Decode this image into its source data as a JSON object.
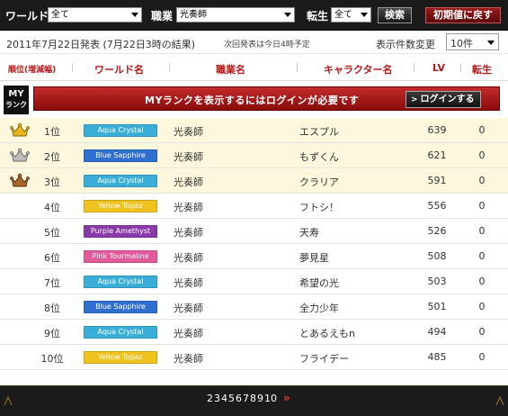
{
  "filters": {
    "world_label": "ワールド",
    "world_value": "全て",
    "job_label": "職業",
    "job_value": "光奏師",
    "rebirth_label": "転生",
    "rebirth_value": "全て",
    "search_button": "検索",
    "reset_button": "初期値に戻す"
  },
  "info": {
    "date": "2011年7月22日発表 (7月22日3時の結果)",
    "next_announce": "次回発表は今日4時予定",
    "count_label": "表示件数変更",
    "count_value": "10件"
  },
  "columns": {
    "rank": "順位(増減幅)",
    "world": "ワールド名",
    "job": "職業名",
    "character": "キャラクター名",
    "lv": "LV",
    "rebirth": "転生"
  },
  "myrank": {
    "label_line1": "MY",
    "label_line2": "ランク",
    "message": "MYランクを表示するにはログインが必要です",
    "login_button": "ログインする"
  },
  "rows": [
    {
      "rank": "1位",
      "world": "Aqua Crystal",
      "job": "光奏師",
      "character": "エスプル",
      "lv": "639",
      "rebirth": "0"
    },
    {
      "rank": "2位",
      "world": "Blue Sapphire",
      "job": "光奏師",
      "character": "もずくん",
      "lv": "621",
      "rebirth": "0"
    },
    {
      "rank": "3位",
      "world": "Aqua Crystal",
      "job": "光奏師",
      "character": "クラリア",
      "lv": "591",
      "rebirth": "0"
    },
    {
      "rank": "4位",
      "world": "Yellow Topaz",
      "job": "光奏師",
      "character": "フトシ！",
      "lv": "556",
      "rebirth": "0"
    },
    {
      "rank": "5位",
      "world": "Purple Amethyst",
      "job": "光奏師",
      "character": "天寿",
      "lv": "526",
      "rebirth": "0"
    },
    {
      "rank": "6位",
      "world": "Pink Tourmaline",
      "job": "光奏師",
      "character": "夢見星",
      "lv": "508",
      "rebirth": "0"
    },
    {
      "rank": "7位",
      "world": "Aqua Crystal",
      "job": "光奏師",
      "character": "希望の光",
      "lv": "503",
      "rebirth": "0"
    },
    {
      "rank": "8位",
      "world": "Blue Sapphire",
      "job": "光奏師",
      "character": "全力少年",
      "lv": "501",
      "rebirth": "0"
    },
    {
      "rank": "9位",
      "world": "Aqua Crystal",
      "job": "光奏師",
      "character": "とあるえもn",
      "lv": "494",
      "rebirth": "0"
    },
    {
      "rank": "10位",
      "world": "Yellow Topaz",
      "job": "光奏師",
      "character": "フライデー",
      "lv": "485",
      "rebirth": "0"
    }
  ],
  "pagination": {
    "pages": [
      "2",
      "3",
      "4",
      "5",
      "6",
      "7",
      "8",
      "9",
      "10"
    ],
    "next": "»"
  },
  "colors": {
    "accent_red": "#b61818",
    "top3_bg": "#fcf7dd",
    "badge_aqua": "#3aaed8",
    "badge_blue": "#2f6fd1",
    "badge_yellow": "#f0c21d",
    "badge_purple": "#8a3aa8",
    "badge_pink": "#e25a9c",
    "crown_gold": "#e8b51e",
    "crown_silver": "#a9a9a9",
    "crown_bronze": "#a8662a"
  },
  "icons": {
    "rank1": "crown-gold-icon",
    "rank2": "crown-silver-icon",
    "rank3": "crown-bronze-icon"
  }
}
